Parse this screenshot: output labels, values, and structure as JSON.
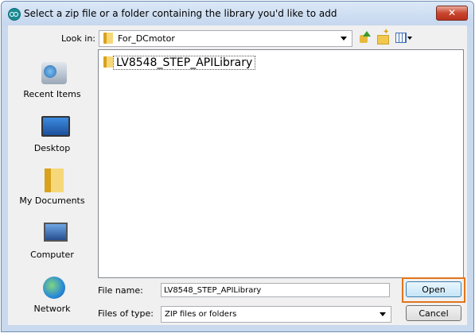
{
  "window": {
    "title": "Select a zip file or a folder containing the library you'd like to add",
    "close_glyph": "✕",
    "app_icon": "arduino-icon"
  },
  "toolbar": {
    "look_in_label": "Look in:",
    "look_in_value": "For_DCmotor",
    "icons": [
      "folder-icon",
      "up-one-level-icon",
      "new-folder-icon",
      "view-menu-icon"
    ]
  },
  "places": [
    {
      "label": "Recent Items",
      "icon": "recent-items-icon"
    },
    {
      "label": "Desktop",
      "icon": "desktop-icon"
    },
    {
      "label": "My Documents",
      "icon": "my-documents-icon"
    },
    {
      "label": "Computer",
      "icon": "computer-icon"
    },
    {
      "label": "Network",
      "icon": "network-icon"
    }
  ],
  "files": [
    {
      "name": "LV8548_STEP_APILibrary",
      "icon": "folder-icon"
    }
  ],
  "form": {
    "file_name_label": "File name:",
    "file_name_value": "LV8548_STEP_APILibrary",
    "file_type_label": "Files of type:",
    "file_type_value": "ZIP files or folders"
  },
  "buttons": {
    "open": "Open",
    "cancel": "Cancel"
  },
  "colors": {
    "highlight": "#e0751b",
    "close_button": "#c9462f"
  }
}
